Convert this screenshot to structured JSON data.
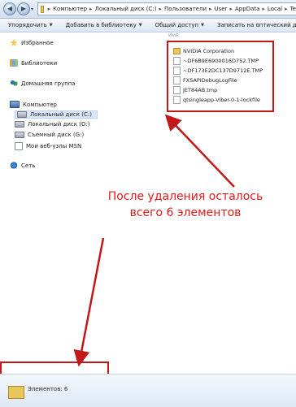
{
  "address": {
    "crumbs": [
      "Компьютер",
      "Локальный диск (C:)",
      "Пользователи",
      "User",
      "AppData",
      "Local",
      "Te"
    ]
  },
  "toolbar": {
    "organize": "Упорядочить",
    "add_library": "Добавить в библиотеку",
    "share": "Общий доступ",
    "burn": "Записать на оптический диск"
  },
  "sidebar": {
    "favorites": "Избранное",
    "libraries": "Библиотеки",
    "homegroup": "Домашняя группа",
    "computer": "Компьютер",
    "drive_c": "Локальный диск (C:)",
    "drive_d": "Локальный диск (D:)",
    "drive_g": "Съемный диск (G:)",
    "msn": "Мои веб-узлы MSN",
    "network": "Сеть"
  },
  "column_header": "Имя",
  "files": [
    {
      "name": "NVIDIA Corporation",
      "icon": "folder-icon"
    },
    {
      "name": "~DF6B9E6900016D752.TMP",
      "icon": "file-icon"
    },
    {
      "name": "~DF173E2DC137D9712E.TMP",
      "icon": "file-icon"
    },
    {
      "name": "FXSAPIDebugLogFile",
      "icon": "file-icon"
    },
    {
      "name": "JET84AB.tmp",
      "icon": "file-icon"
    },
    {
      "name": "qtsingleapp-Viber-0-1-lockfile",
      "icon": "file-icon"
    }
  ],
  "annotation": {
    "text": "После удаления осталось всего 6 элементов",
    "color": "#e01a1a"
  },
  "status": {
    "items": "Элементов: 6"
  }
}
